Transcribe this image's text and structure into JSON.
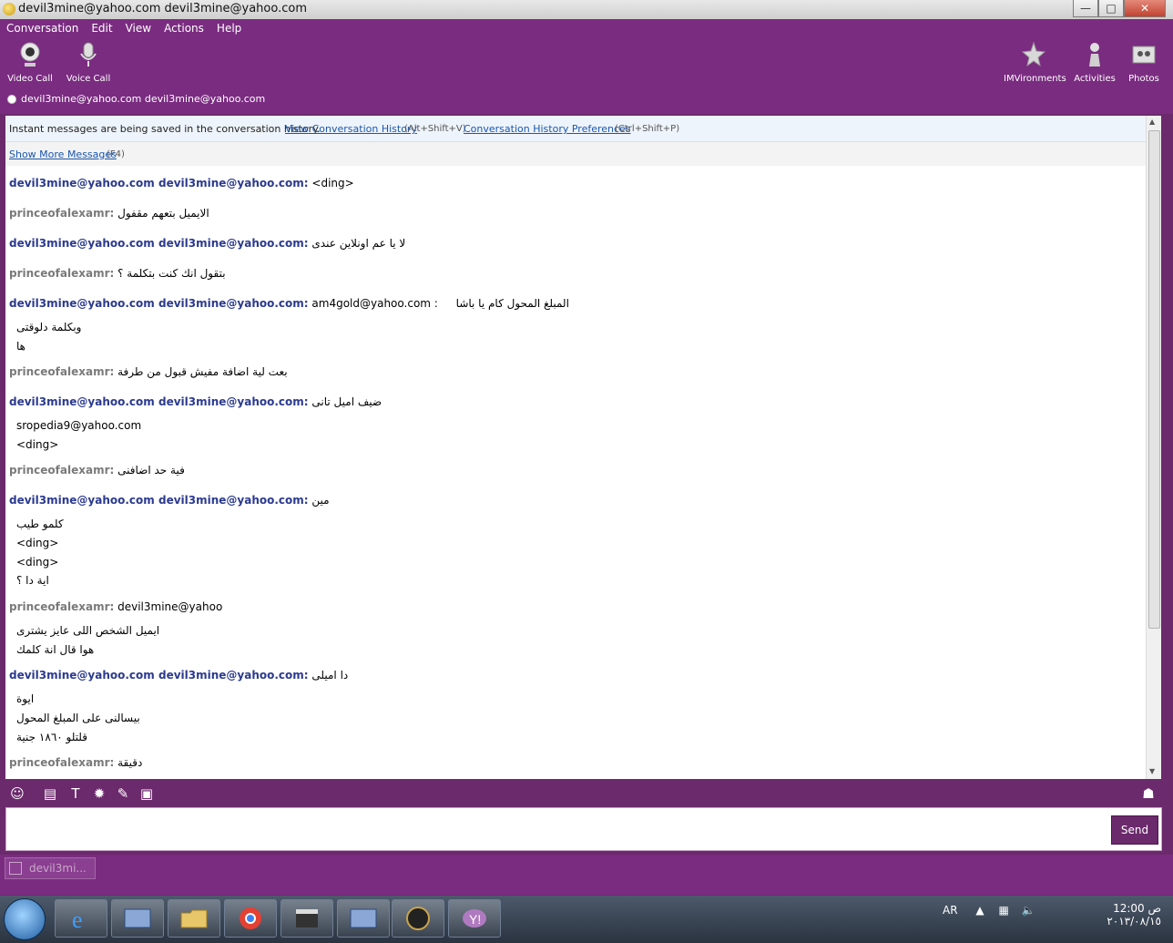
{
  "window": {
    "title": "devil3mine@yahoo.com devil3mine@yahoo.com",
    "min": "—",
    "max": "□",
    "close": "✕"
  },
  "menu": [
    "Conversation",
    "Edit",
    "View",
    "Actions",
    "Help"
  ],
  "toolbar_left": [
    {
      "label": "Video Call",
      "icon": "webcam-icon"
    },
    {
      "label": "Voice Call",
      "icon": "microphone-icon"
    }
  ],
  "toolbar_right": [
    {
      "label": "IMVironments",
      "icon": "imvironments-icon"
    },
    {
      "label": "Activities",
      "icon": "activities-icon"
    },
    {
      "label": "Photos",
      "icon": "photos-icon"
    }
  ],
  "contact_line": "devil3mine@yahoo.com devil3mine@yahoo.com",
  "infobar": {
    "text": "Instant messages are being saved in the conversation history.",
    "history_link": "View Conversation History",
    "history_hint": "(Alt+Shift+V)",
    "prefs_link": "Conversation History Preferences",
    "prefs_hint": "(Ctrl+Shift+P)"
  },
  "more": {
    "link": "Show More Messages",
    "hint": "(F4)"
  },
  "messages": [
    {
      "sender": "devil3mine@yahoo.com devil3mine@yahoo.com:",
      "text": "<ding>"
    },
    {
      "sender": "princeofalexamr:",
      "text": "الايميل بتعهم مقفول"
    },
    {
      "sender": "devil3mine@yahoo.com devil3mine@yahoo.com:",
      "text": "لا يا عم اونلاين عندى"
    },
    {
      "sender": "princeofalexamr:",
      "text": "بتقول انك كنت بتكلمة ؟"
    },
    {
      "sender": "devil3mine@yahoo.com devil3mine@yahoo.com:",
      "text": "am4gold@yahoo.com :",
      "text2": "المبلغ المحول كام يا باشا"
    },
    {
      "sub": "وبكلمة دلوقتى"
    },
    {
      "sub": "ها"
    },
    {
      "sender": "princeofalexamr:",
      "text": "بعت لية اضافة مفيش قبول من طرفة"
    },
    {
      "sender": "devil3mine@yahoo.com devil3mine@yahoo.com:",
      "text": "ضيف اميل تانى"
    },
    {
      "sub": "sropedia9@yahoo.com"
    },
    {
      "sub": "<ding>"
    },
    {
      "sender": "princeofalexamr:",
      "text": "فية حد اضافنى"
    },
    {
      "sender": "devil3mine@yahoo.com devil3mine@yahoo.com:",
      "text": "مين"
    },
    {
      "sub": "كلمو طيب"
    },
    {
      "sub": "<ding>"
    },
    {
      "sub": "<ding>"
    },
    {
      "sub": "اية دا ؟"
    },
    {
      "sender": "princeofalexamr:",
      "text": "devil3mine@yahoo"
    },
    {
      "sub": "ايميل الشخص اللى عايز يشترى"
    },
    {
      "sub": "هوا قال انة كلمك"
    },
    {
      "sender": "devil3mine@yahoo.com devil3mine@yahoo.com:",
      "text": "دا اميلى"
    },
    {
      "sub": "ايوة"
    },
    {
      "sub": "بيسالنى على المبلغ المحول"
    },
    {
      "sub": "قلتلو ١٨٦٠ جنية"
    },
    {
      "sender": "princeofalexamr:",
      "text": "دقيقة"
    }
  ],
  "composer": {
    "send_label": "Send",
    "value": ""
  },
  "tab": {
    "label": "devil3mi..."
  },
  "tray": {
    "lang": "AR",
    "time": "12:00 ص",
    "date": "٢٠١٣/٠٨/١٥"
  }
}
